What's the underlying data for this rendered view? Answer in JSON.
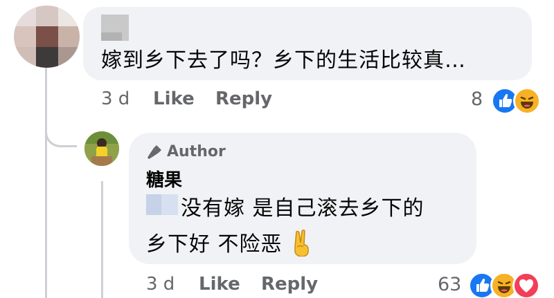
{
  "comment": {
    "text": "嫁到乡下去了吗？乡下的生活比较真…",
    "time": "3 d",
    "like_label": "Like",
    "reply_label": "Reply",
    "reaction_count": "8",
    "reactions": [
      "like-icon",
      "haha-icon"
    ]
  },
  "reply": {
    "badge": "Author",
    "name": "糖果",
    "text_line1": "没有嫁 是自己滚去乡下的",
    "text_line2": "乡下好 不险恶",
    "emoji": "victory-hand-icon",
    "time": "3 d",
    "like_label": "Like",
    "reply_label": "Reply",
    "reaction_count": "63",
    "reactions": [
      "like-icon",
      "haha-icon",
      "love-icon"
    ]
  },
  "colors": {
    "bubble_bg": "#f0f2f5",
    "muted_text": "#65676b",
    "text": "#050505",
    "like_blue": "#1877f2",
    "haha_yellow": "#f7b125",
    "love_red": "#f33e58"
  }
}
